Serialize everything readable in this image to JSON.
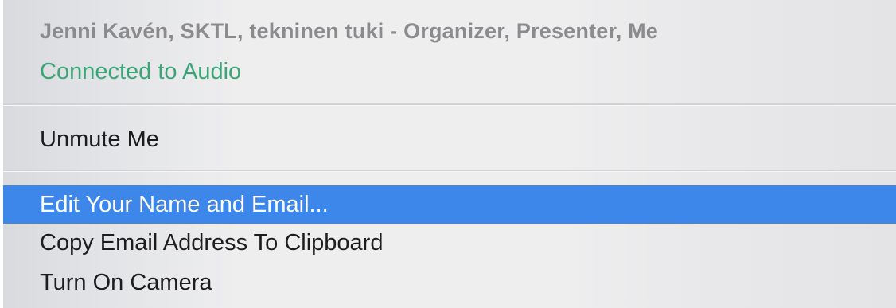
{
  "context_menu": {
    "header": {
      "participant_name": "Jenni Kavén, SKTL, tekninen tuki - Organizer, Presenter, Me",
      "audio_status": "Connected to Audio"
    },
    "items": [
      {
        "label": "Unmute Me",
        "highlighted": false
      },
      {
        "label": "Edit Your Name and Email...",
        "highlighted": true
      },
      {
        "label": "Copy Email Address To Clipboard",
        "highlighted": false
      },
      {
        "label": "Turn On Camera",
        "highlighted": false
      }
    ],
    "colors": {
      "highlight": "#3d87ea",
      "audio_status": "#3aa678",
      "name_text": "#8b8b8e"
    }
  }
}
